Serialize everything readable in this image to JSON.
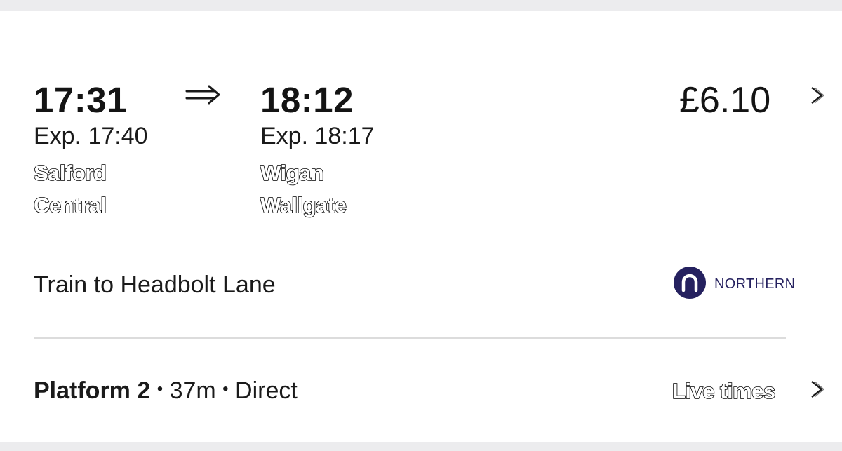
{
  "journey": {
    "departure": {
      "time": "17:31",
      "expected": "Exp. 17:40",
      "station_line1": "Salford",
      "station_line2": "Central"
    },
    "arrival": {
      "time": "18:12",
      "expected": "Exp. 18:17",
      "station_line1": "Wigan",
      "station_line2": "Wallgate"
    },
    "price": "£6.10",
    "service": "Train to Headbolt Lane",
    "operator": {
      "name": "NORTHERN",
      "color": "#25215f"
    },
    "footer": {
      "platform": "Platform 2",
      "separator": "•",
      "duration": "37m",
      "changes": "Direct",
      "live_times_label": "Live times"
    }
  },
  "icons": {
    "arrow": "double-arrow-right-icon",
    "chevron": "chevron-right-icon",
    "operator_logo": "northern-logo-icon"
  }
}
